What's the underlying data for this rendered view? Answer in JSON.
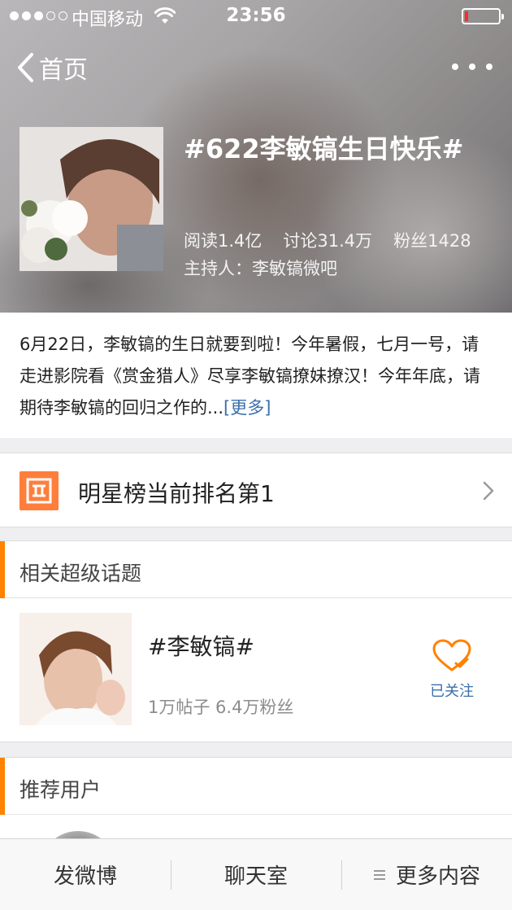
{
  "status_bar": {
    "carrier": "中国移动",
    "time": "23:56",
    "battery_level": 0.1,
    "battery_color": "#ff2b2b"
  },
  "nav": {
    "back_label": "首页",
    "back_icon": "chevron-left-icon",
    "more_icon": "more-dots-icon"
  },
  "topic": {
    "title": "#622李敏镐生日快乐#",
    "stats": {
      "reads": "阅读1.4亿",
      "discussions": "讨论31.4万",
      "fans": "粉丝1428"
    },
    "host": "主持人：李敏镐微吧"
  },
  "description": {
    "text": "6月22日，李敏镐的生日就要到啦！今年暑假，七月一号，请走进影院看《赏金猎人》尽享李敏镐撩妹撩汉！今年年底，请期待李敏镐的回归之作的...",
    "more_label": "[更多]"
  },
  "ranking": {
    "text": "明星榜当前排名第1",
    "icon": "ranking-icon",
    "icon_color": "#ff7e3c"
  },
  "related": {
    "section_title": "相关超级话题",
    "accent_color": "#ff8200",
    "topic_name": "#李敏镐#",
    "topic_meta": "1万帖子 6.4万粉丝",
    "follow_label": "已关注",
    "follow_icon": "heart-check-icon"
  },
  "recommend": {
    "section_title": "推荐用户"
  },
  "tabbar": {
    "post": "发微博",
    "chat": "聊天室",
    "more": "更多内容",
    "more_icon": "menu-icon"
  },
  "colors": {
    "link": "#3a6fae",
    "accent": "#ff8200"
  }
}
